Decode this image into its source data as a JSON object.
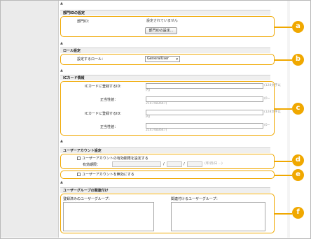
{
  "sections": {
    "dept": {
      "header": "部門IDの設定",
      "label": "部門ID：",
      "value": "設定されていません",
      "button": "部門IDの設定..."
    },
    "role": {
      "header": "ロール設定",
      "label": "設定するロール：",
      "selected": "GeneralUser"
    },
    "ic": {
      "header": "ICカード情報",
      "card1_label": "ICカードに登録するID：",
      "card1_hint1": "(128文字以",
      "card1_hint2": "内)",
      "card1_num_label": "正当性値：",
      "card1_num_hint1": "(0~",
      "card1_num_hint2": "2147483647)",
      "card2_label": "ICカードに登録するID：",
      "card2_hint1": "(128文字以",
      "card2_hint2": "内)",
      "card2_num_label": "正当性値：",
      "card2_num_hint1": "(0~",
      "card2_num_hint2": "2147483647)"
    },
    "account": {
      "header": "ユーザーアカウント設定",
      "expiry_checkbox": "ユーザーアカウントの有効期限を設定する",
      "expiry_label": "有効期限：",
      "slash": "/",
      "date_hint": "(年/月/日 ...)",
      "disable_checkbox": "ユーザーアカウントを無効にする"
    },
    "groups": {
      "header": "ユーザーグループの関連付け",
      "registered_label": "登録済みのユーザーグループ：",
      "associate_label": "関連付けるユーザーグループ："
    }
  },
  "callouts": [
    "a",
    "b",
    "c",
    "d",
    "e",
    "f"
  ],
  "accent_color": "#f0a800"
}
